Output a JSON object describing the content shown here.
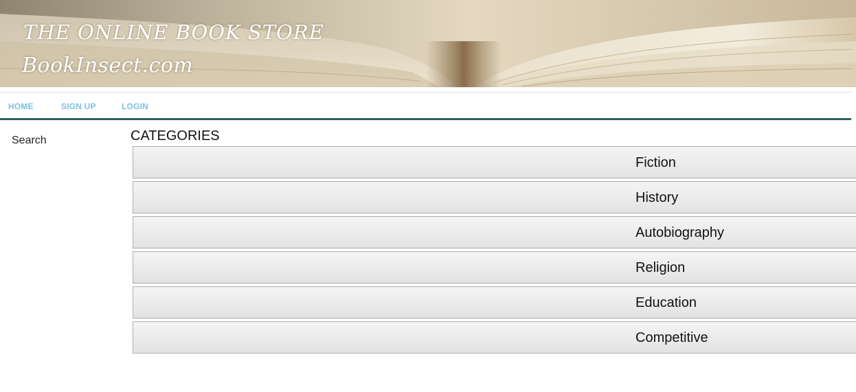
{
  "banner": {
    "title": "THE ONLINE BOOK STORE",
    "subtitle": "BookInsect.com"
  },
  "nav": {
    "items": [
      {
        "label": "HOME"
      },
      {
        "label": "SIGN UP"
      },
      {
        "label": "LOGIN"
      }
    ],
    "link_color": "#7ec0e0",
    "divider_color": "#2e5f60"
  },
  "sidebar": {
    "search_label": "Search"
  },
  "categories": {
    "heading": "CATEGORIES",
    "items": [
      {
        "label": "Fiction"
      },
      {
        "label": "History"
      },
      {
        "label": "Autobiography"
      },
      {
        "label": "Religion"
      },
      {
        "label": "Education"
      },
      {
        "label": "Competitive"
      }
    ]
  }
}
